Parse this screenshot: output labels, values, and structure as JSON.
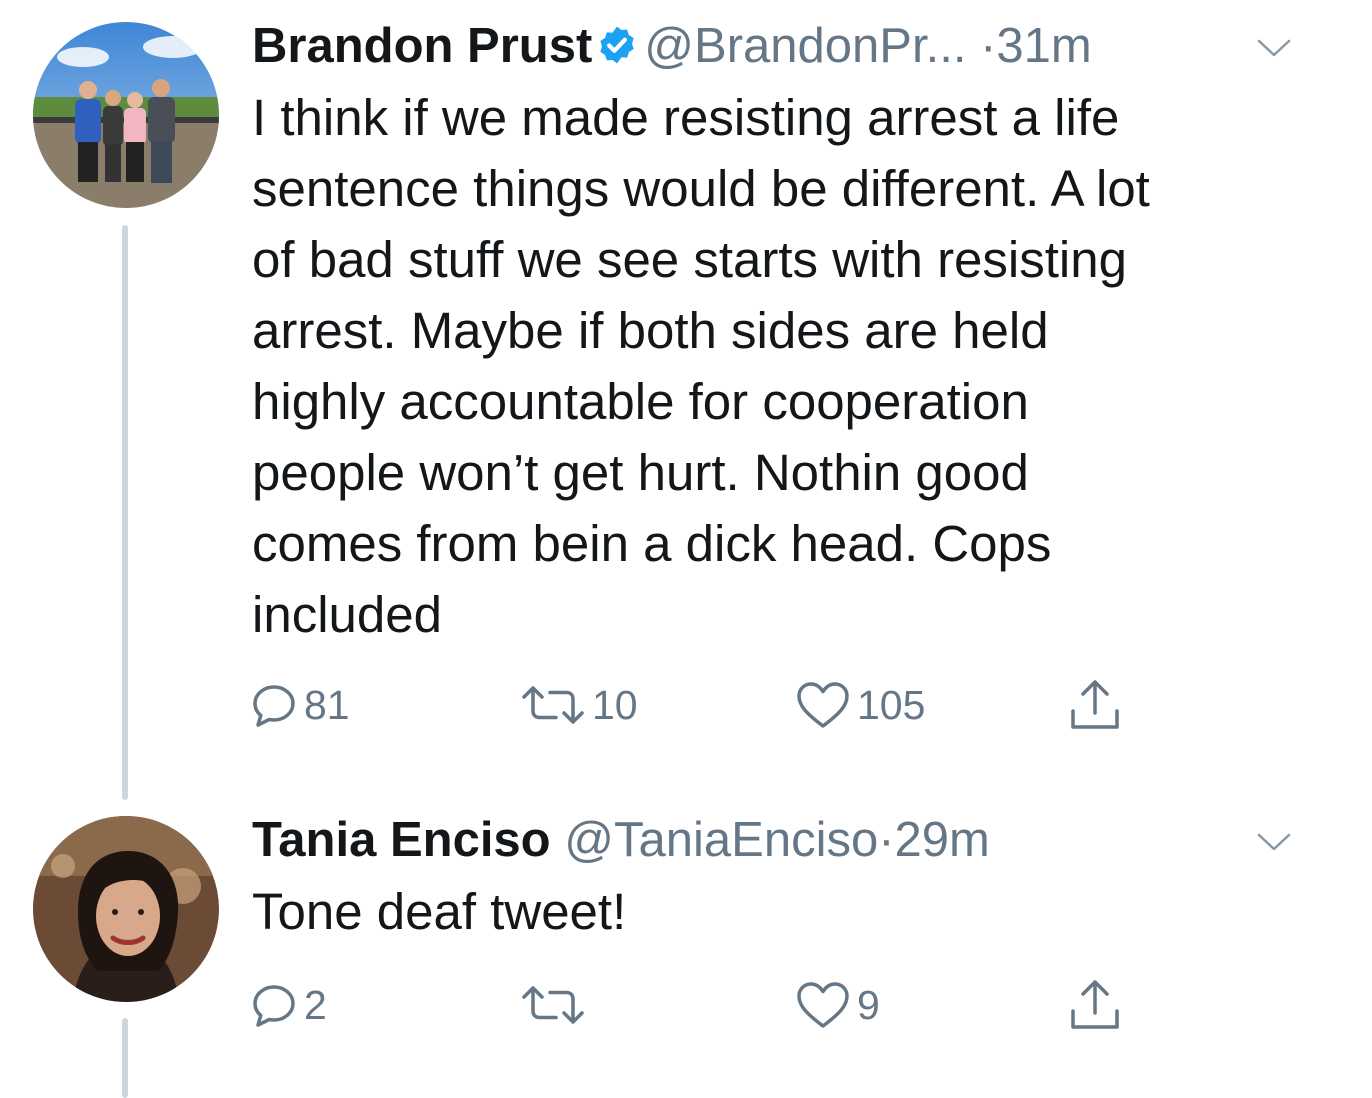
{
  "tweets": [
    {
      "name": "Brandon Prust",
      "verified": true,
      "handle": "@BrandonPr...",
      "separator": "·",
      "time": "31m",
      "lines": [
        "I think if we made resisting arrest a life",
        "sentence things would be different. A lot",
        "of bad stuff we see starts with resisting",
        "arrest. Maybe if both sides are held",
        "highly accountable for cooperation",
        "people won’t get hurt. Nothin good",
        "comes from bein a dick head. Cops",
        "included"
      ],
      "replies": "81",
      "retweets": "10",
      "likes": "105"
    },
    {
      "name": "Tania Enciso",
      "handle": "@TaniaEnciso",
      "separator": "·",
      "time": "29m",
      "lines": [
        "Tone deaf tweet!"
      ],
      "replies": "2",
      "retweets": "",
      "likes": "9"
    }
  ],
  "colors": {
    "text": "#14171a",
    "secondary": "#657786",
    "verified": "#1da1f2",
    "thread_line": "#cdd6dd"
  },
  "icons": [
    "reply-icon",
    "retweet-icon",
    "like-icon",
    "share-icon",
    "verified-badge-icon",
    "chevron-down-icon"
  ]
}
